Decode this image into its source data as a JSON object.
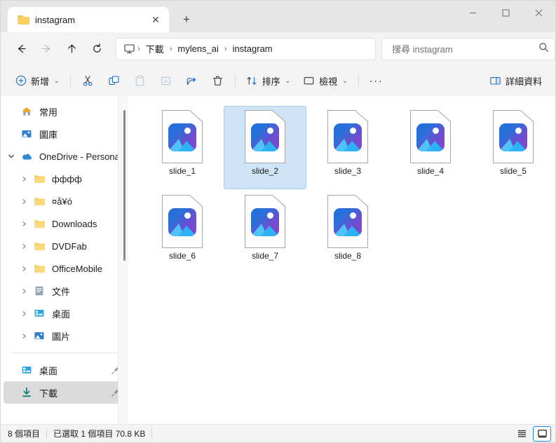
{
  "window": {
    "tab_title": "instagram",
    "tab_close_glyph": "✕",
    "new_tab_glyph": "+",
    "minimize_label": "minimize",
    "maximize_label": "maximize",
    "close_label": "close"
  },
  "address": {
    "back_label": "上一頁",
    "forward_label": "下一頁",
    "up_label": "上一層",
    "refresh_label": "重新整理",
    "breadcrumbs": [
      {
        "label": "下載"
      },
      {
        "label": "mylens_ai"
      },
      {
        "label": "instagram"
      }
    ],
    "separator": "›"
  },
  "search": {
    "placeholder": "搜尋 instagram"
  },
  "toolbar": {
    "new_label": "新增",
    "cut_label": "剪下",
    "copy_label": "複製",
    "paste_label": "貼上",
    "rename_label": "重新命名",
    "share_label": "共用",
    "delete_label": "刪除",
    "sort_label": "排序",
    "view_label": "檢視",
    "more_label": "···",
    "details_label": "詳細資料",
    "chevron": "⌄"
  },
  "sidebar": {
    "items": [
      {
        "label": "常用",
        "icon": "home-icon",
        "level": "flat",
        "expandable": false,
        "selected": false,
        "pinned": false
      },
      {
        "label": "圖庫",
        "icon": "gallery-icon",
        "level": "flat",
        "expandable": false,
        "selected": false,
        "pinned": false
      },
      {
        "label": "OneDrive - Personal",
        "icon": "onedrive-icon",
        "level": "root",
        "expandable": true,
        "expanded": true,
        "selected": false,
        "pinned": false
      },
      {
        "label": "фффф",
        "icon": "folder-icon",
        "level": "child",
        "expandable": true,
        "expanded": false,
        "selected": false,
        "pinned": false
      },
      {
        "label": "¤å¥ó",
        "icon": "folder-icon",
        "level": "child",
        "expandable": true,
        "expanded": false,
        "selected": false,
        "pinned": false
      },
      {
        "label": "Downloads",
        "icon": "folder-icon",
        "level": "child",
        "expandable": true,
        "expanded": false,
        "selected": false,
        "pinned": false
      },
      {
        "label": "DVDFab",
        "icon": "folder-icon",
        "level": "child",
        "expandable": true,
        "expanded": false,
        "selected": false,
        "pinned": false
      },
      {
        "label": "OfficeMobile",
        "icon": "folder-icon",
        "level": "child",
        "expandable": true,
        "expanded": false,
        "selected": false,
        "pinned": false
      },
      {
        "label": "文件",
        "icon": "documents-icon",
        "level": "child",
        "expandable": true,
        "expanded": false,
        "selected": false,
        "pinned": false
      },
      {
        "label": "桌面",
        "icon": "desktop-icon",
        "level": "child",
        "expandable": true,
        "expanded": false,
        "selected": false,
        "pinned": false
      },
      {
        "label": "圖片",
        "icon": "pictures-icon",
        "level": "child",
        "expandable": true,
        "expanded": false,
        "selected": false,
        "pinned": false
      }
    ],
    "quick_items": [
      {
        "label": "桌面",
        "icon": "desktop-icon",
        "selected": false,
        "pinned": true
      },
      {
        "label": "下載",
        "icon": "downloads-icon",
        "selected": true,
        "pinned": true
      }
    ]
  },
  "files": [
    {
      "name": "slide_1",
      "selected": false
    },
    {
      "name": "slide_2",
      "selected": true
    },
    {
      "name": "slide_3",
      "selected": false
    },
    {
      "name": "slide_4",
      "selected": false
    },
    {
      "name": "slide_5",
      "selected": false
    },
    {
      "name": "slide_6",
      "selected": false
    },
    {
      "name": "slide_7",
      "selected": false
    },
    {
      "name": "slide_8",
      "selected": false
    }
  ],
  "status": {
    "item_count": "8 個項目",
    "selection": "已選取 1 個項目  70.8 KB",
    "list_view_label": "詳細資料檢視",
    "icon_view_label": "大圖示檢視"
  },
  "colors": {
    "accent": "#1a8fe0",
    "selection_fill": "#cfe4f7",
    "selection_border": "#a8cdec",
    "titlebar": "#e6e6e6",
    "chrome": "#f3f3f3"
  }
}
